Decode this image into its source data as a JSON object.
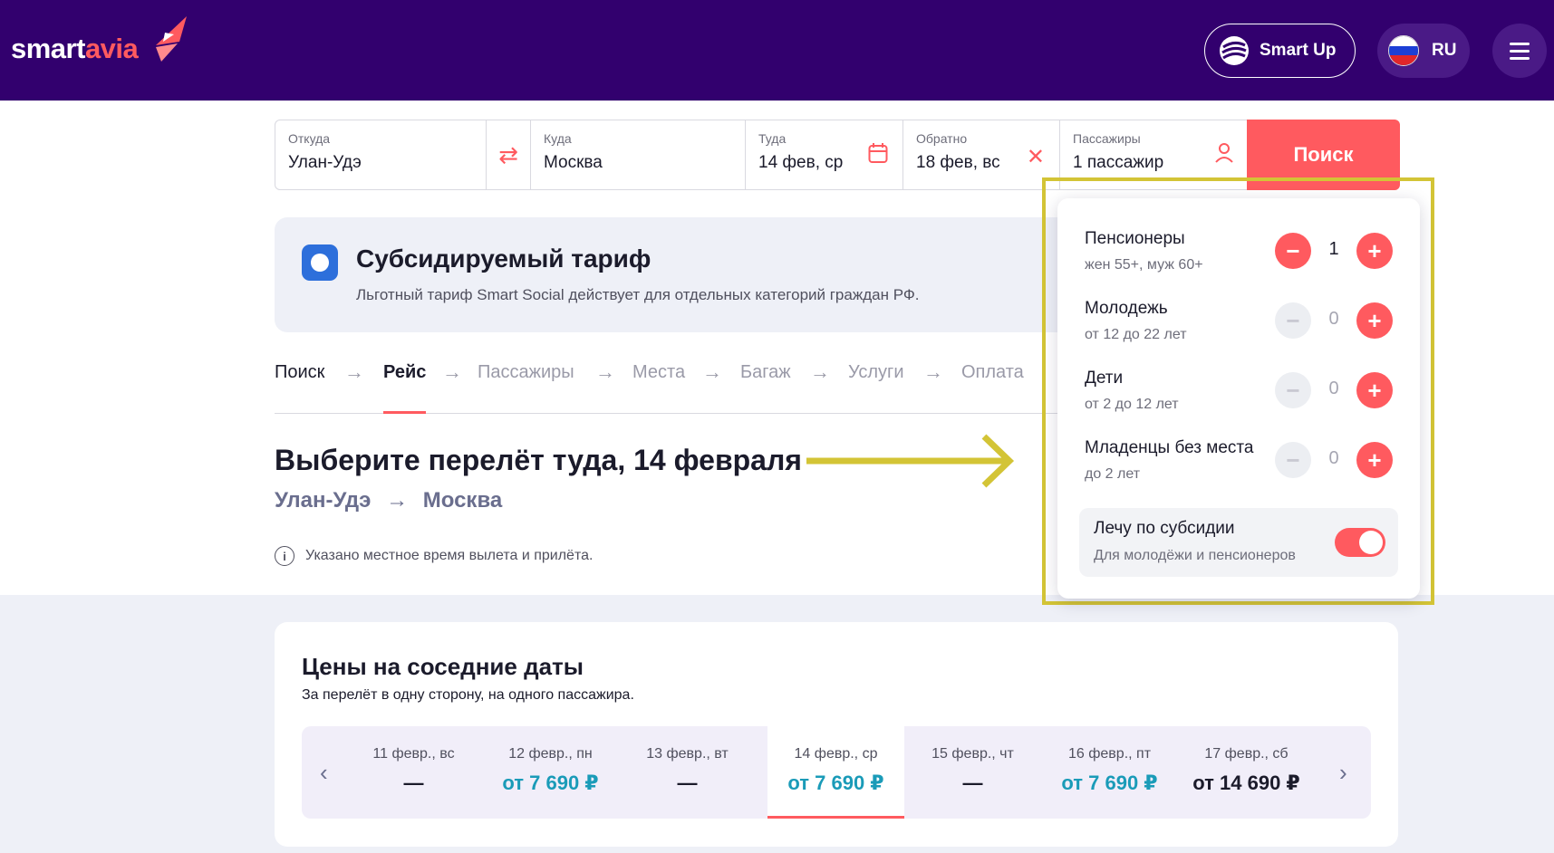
{
  "header": {
    "logo_part1": "smart",
    "logo_part2": "avia",
    "smartup_label": "Smart Up",
    "lang_label": "RU"
  },
  "search": {
    "from_label": "Откуда",
    "from_value": "Улан-Удэ",
    "to_label": "Куда",
    "to_value": "Москва",
    "there_label": "Туда",
    "there_value": "14 фев, ср",
    "back_label": "Обратно",
    "back_value": "18 фев, вс",
    "pax_label": "Пассажиры",
    "pax_value": "1 пассажир",
    "button": "Поиск"
  },
  "banner": {
    "title": "Субсидируемый тариф",
    "text": "Льготный тариф Smart Social действует для отдельных категорий граждан РФ."
  },
  "steps": [
    "Поиск",
    "Рейс",
    "Пассажиры",
    "Места",
    "Багаж",
    "Услуги",
    "Оплата"
  ],
  "main": {
    "title": "Выберите перелёт туда, 14 февраля",
    "route_from": "Улан-Удэ",
    "route_to": "Москва",
    "note": "Указано местное время вылета и прилёта."
  },
  "passengers": {
    "rows": [
      {
        "title": "Пенсионеры",
        "sub": "жен 55+, муж 60+",
        "count": "1"
      },
      {
        "title": "Молодежь",
        "sub": "от 12 до 22 лет",
        "count": "0"
      },
      {
        "title": "Дети",
        "sub": "от 2 до 12 лет",
        "count": "0"
      },
      {
        "title": "Младенцы без места",
        "sub": "до 2 лет",
        "count": "0"
      }
    ],
    "subsidy_title": "Лечу по субсидии",
    "subsidy_sub": "Для молодёжи и пенсионеров",
    "subsidy_on": true
  },
  "prices": {
    "title": "Цены на соседние даты",
    "subtitle": "За перелёт в одну сторону, на одного пассажира.",
    "days": [
      {
        "date": "11 февр., вс",
        "price": "—"
      },
      {
        "date": "12 февр., пн",
        "price": "от 7 690 ₽"
      },
      {
        "date": "13 февр., вт",
        "price": "—"
      },
      {
        "date": "14 февр., ср",
        "price": "от 7 690 ₽"
      },
      {
        "date": "15 февр., чт",
        "price": "—"
      },
      {
        "date": "16 февр., пт",
        "price": "от 7 690 ₽"
      },
      {
        "date": "17 февр., сб",
        "price": "от 14 690 ₽"
      }
    ]
  },
  "colors": {
    "header_bg": "#32006e",
    "accent": "#ff5a5f",
    "price_teal": "#1a9bb8",
    "annotation": "#d3c436"
  }
}
